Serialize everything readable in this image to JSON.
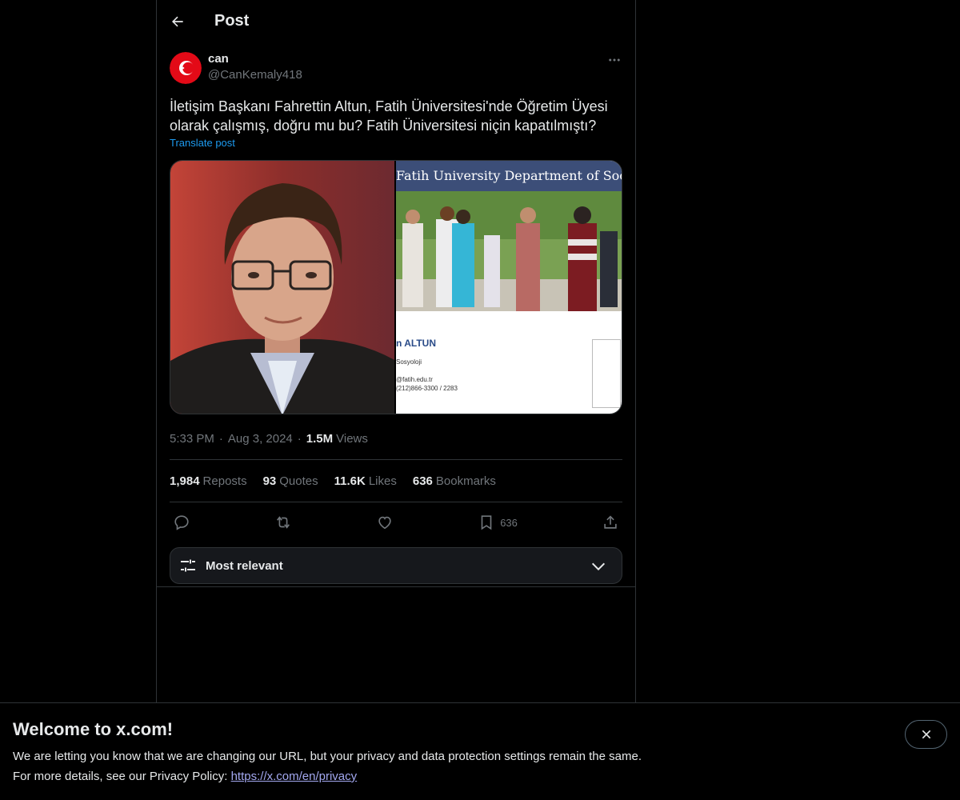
{
  "header": {
    "title": "Post"
  },
  "post": {
    "author": {
      "display_name": "can",
      "handle": "@CanKemaly418"
    },
    "text": "İletişim Başkanı Fahrettin Altun, Fatih Üniversitesi'nde Öğretim Üyesi olarak çalışmış, doğru mu bu? Fatih Üniversitesi niçin kapatılmıştı?",
    "translate_label": "Translate post",
    "media_right": {
      "banner_text": "Fatih University Department of Socio",
      "name_text": "n ALTUN",
      "dept_text": "Sosyoloji",
      "email_text": "@fatih.edu.tr",
      "phone_text": "(212)866-3300 / 2283"
    },
    "time": "5:33 PM",
    "date": "Aug 3, 2024",
    "views_count": "1.5M",
    "views_label": "Views"
  },
  "stats": {
    "reposts_count": "1,984",
    "reposts_label": "Reposts",
    "quotes_count": "93",
    "quotes_label": "Quotes",
    "likes_count": "11.6K",
    "likes_label": "Likes",
    "bookmarks_count": "636",
    "bookmarks_label": "Bookmarks"
  },
  "actions": {
    "bookmark_count": "636"
  },
  "sort": {
    "label": "Most relevant"
  },
  "banner": {
    "title": "Welcome to x.com!",
    "line1": "We are letting you know that we are changing our URL, but your privacy and data protection settings remain the same.",
    "line2_prefix": "For more details, see our Privacy Policy: ",
    "link": "https://x.com/en/privacy"
  },
  "icons": {
    "back": "arrow-left-icon",
    "more": "more-horizontal-icon",
    "reply": "reply-icon",
    "repost": "repost-icon",
    "like": "heart-icon",
    "bookmark": "bookmark-icon",
    "share": "share-icon",
    "sort": "sliders-icon",
    "chevron": "chevron-down-icon",
    "close": "close-icon"
  },
  "colors": {
    "background": "#000000",
    "text": "#e7e9ea",
    "secondary": "#71767b",
    "accent": "#1d9bf0",
    "border": "#2f3336"
  }
}
